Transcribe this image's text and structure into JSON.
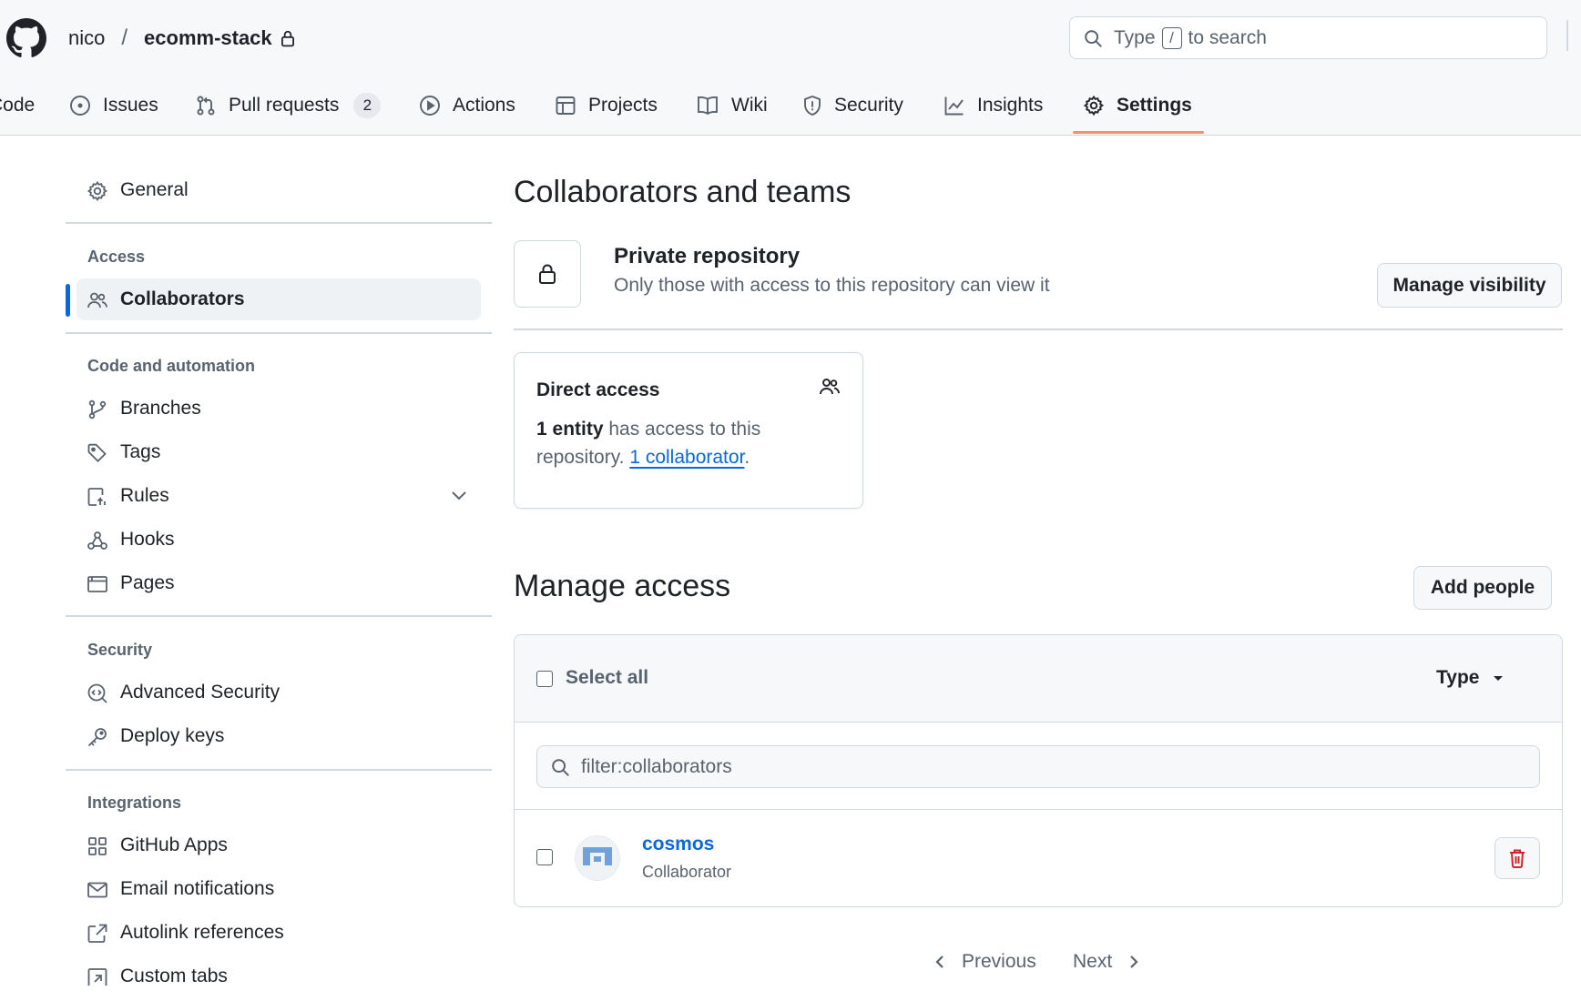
{
  "header": {
    "owner": "nico",
    "separator": "/",
    "repo": "ecomm-stack",
    "search": {
      "prefix": "Type",
      "key": "/",
      "suffix": "to search"
    }
  },
  "tabs": [
    {
      "label": "Code",
      "icon": "code-icon"
    },
    {
      "label": "Issues",
      "icon": "issue-icon"
    },
    {
      "label": "Pull requests",
      "icon": "pull-request-icon",
      "count": "2"
    },
    {
      "label": "Actions",
      "icon": "play-icon"
    },
    {
      "label": "Projects",
      "icon": "table-icon"
    },
    {
      "label": "Wiki",
      "icon": "book-icon"
    },
    {
      "label": "Security",
      "icon": "shield-icon"
    },
    {
      "label": "Insights",
      "icon": "graph-icon"
    },
    {
      "label": "Settings",
      "icon": "gear-icon",
      "active": true
    }
  ],
  "sidebar": {
    "general": "General",
    "groups": {
      "access": "Access",
      "code_automation": "Code and automation",
      "security": "Security",
      "integrations": "Integrations"
    },
    "items": {
      "collaborators": "Collaborators",
      "branches": "Branches",
      "tags": "Tags",
      "rules": "Rules",
      "hooks": "Hooks",
      "pages": "Pages",
      "advanced_security": "Advanced Security",
      "deploy_keys": "Deploy keys",
      "github_apps": "GitHub Apps",
      "email_notifications": "Email notifications",
      "autolink_references": "Autolink references",
      "custom_tabs": "Custom tabs"
    }
  },
  "main": {
    "title": "Collaborators and teams",
    "private": {
      "title": "Private repository",
      "description": "Only those with access to this repository can view it",
      "button": "Manage visibility"
    },
    "direct_access": {
      "title": "Direct access",
      "count_bold": "1 entity",
      "text_1": " has access to this repository. ",
      "link": "1 collaborator",
      "text_2": "."
    },
    "manage_access": {
      "title": "Manage access",
      "add_button": "Add people",
      "select_all": "Select all",
      "type_dropdown": "Type",
      "filter_value": "filter:collaborators",
      "members": [
        {
          "name": "cosmos",
          "role": "Collaborator"
        }
      ]
    },
    "pagination": {
      "previous": "Previous",
      "next": "Next"
    }
  },
  "colors": {
    "accent": "#0969da",
    "tab_underline": "#fd8c73",
    "danger": "#d1242f",
    "muted_text": "#59636e",
    "border": "#d1d9e0"
  }
}
